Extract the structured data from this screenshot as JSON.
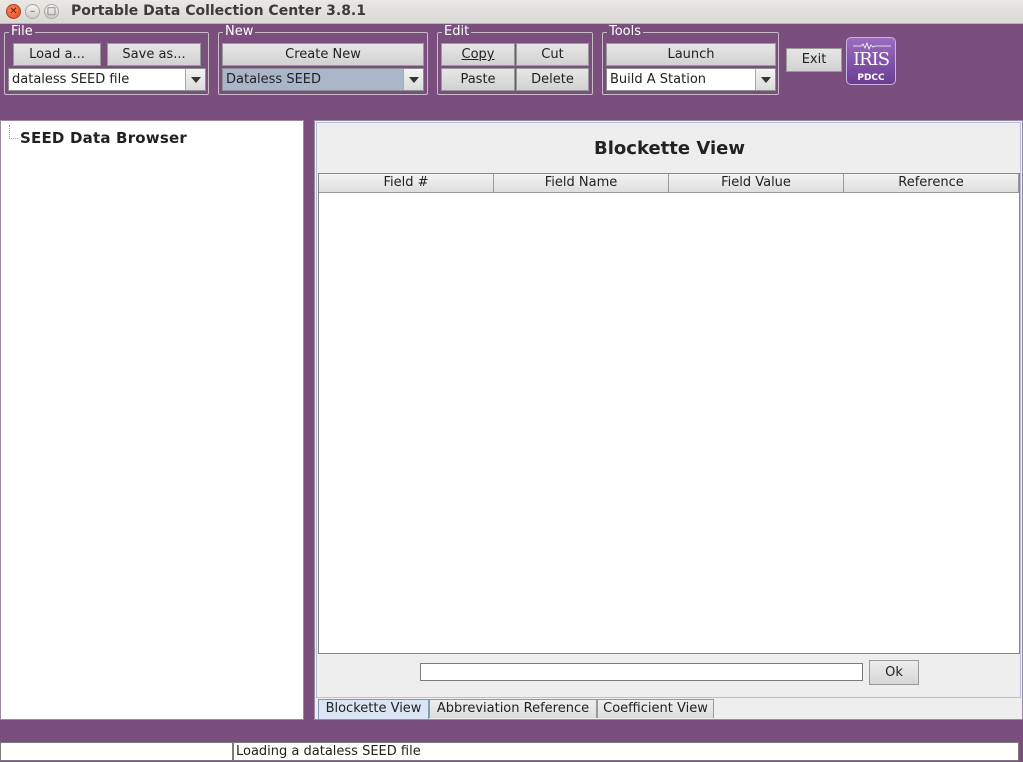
{
  "window": {
    "title": "Portable Data Collection Center 3.8.1"
  },
  "toolbar": {
    "file": {
      "legend": "File",
      "load_label": "Load a...",
      "save_label": "Save as...",
      "type_selected": "dataless SEED file"
    },
    "new": {
      "legend": "New",
      "create_label": "Create New",
      "type_selected": "Dataless SEED"
    },
    "edit": {
      "legend": "Edit",
      "copy_label": "Copy",
      "cut_label": "Cut",
      "paste_label": "Paste",
      "delete_label": "Delete"
    },
    "tools": {
      "legend": "Tools",
      "launch_label": "Launch",
      "tool_selected": "Build A Station"
    },
    "exit_label": "Exit",
    "logo": {
      "text": "IRIS",
      "sub": "PDCC"
    }
  },
  "tree": {
    "root_label": "SEED Data Browser"
  },
  "blockette": {
    "title": "Blockette View",
    "columns": [
      "Field #",
      "Field Name",
      "Field Value",
      "Reference"
    ],
    "rows": [],
    "ok_label": "Ok"
  },
  "tabs": [
    {
      "label": "Blockette View",
      "active": true
    },
    {
      "label": "Abbreviation Reference",
      "active": false
    },
    {
      "label": "Coefficient View",
      "active": false
    }
  ],
  "status": {
    "left": "",
    "message": "Loading a dataless SEED file"
  },
  "colors": {
    "window_bg": "#7a4f7e",
    "accent": "#6a3d93",
    "tab_active": "#dce5f3",
    "combo_selected": "#a9b6c9"
  }
}
